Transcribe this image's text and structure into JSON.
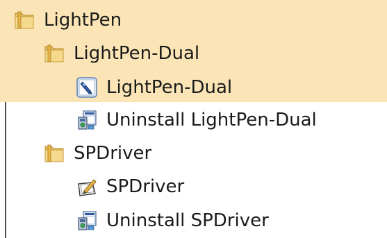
{
  "colors": {
    "selection_highlight": "#fbe5b6",
    "text": "#1a1a1a"
  },
  "tree": {
    "items": [
      {
        "label": "LightPen",
        "icon": "folder-icon"
      },
      {
        "label": "LightPen-Dual",
        "icon": "folder-icon"
      },
      {
        "label": "LightPen-Dual",
        "icon": "pen-app-icon"
      },
      {
        "label": "Uninstall LightPen-Dual",
        "icon": "uninstall-icon"
      },
      {
        "label": "SPDriver",
        "icon": "folder-icon"
      },
      {
        "label": "SPDriver",
        "icon": "tablet-pen-icon"
      },
      {
        "label": "Uninstall SPDriver",
        "icon": "uninstall-icon"
      }
    ]
  }
}
